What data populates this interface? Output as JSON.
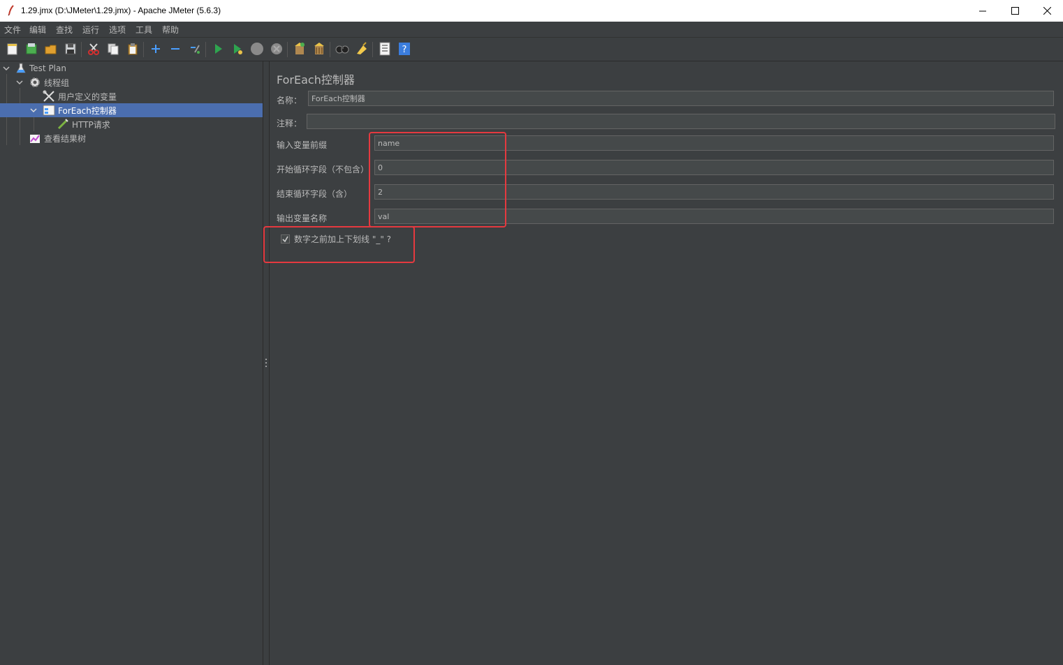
{
  "window": {
    "title": "1.29.jmx (D:\\JMeter\\1.29.jmx) - Apache JMeter (5.6.3)"
  },
  "menu": [
    "文件",
    "编辑",
    "查找",
    "运行",
    "选项",
    "工具",
    "帮助"
  ],
  "toolbar": [
    "new-icon",
    "templates-icon",
    "open-icon",
    "save-icon",
    "cut-icon",
    "copy-icon",
    "paste-icon",
    "expand-icon",
    "collapse-icon",
    "toggle-icon",
    "start-icon",
    "start-no-pauses-icon",
    "stop-icon",
    "shutdown-icon",
    "clear-icon",
    "clear-all-icon",
    "search-icon",
    "reset-search-icon",
    "function-helper-icon",
    "help-icon"
  ],
  "tree": {
    "nodes": [
      {
        "label": "Test Plan",
        "icon": "flask-icon"
      },
      {
        "label": "线程组",
        "icon": "gear-icon"
      },
      {
        "label": "用户定义的变量",
        "icon": "wrench-icon"
      },
      {
        "label": "ForEach控制器",
        "icon": "controller-icon",
        "selected": true
      },
      {
        "label": "HTTP请求",
        "icon": "pipette-icon"
      },
      {
        "label": "查看结果树",
        "icon": "chart-icon"
      }
    ]
  },
  "panel": {
    "title": "ForEach控制器",
    "name_label": "名称：",
    "name_value": "ForEach控制器",
    "comment_label": "注释：",
    "comment_value": "",
    "input_prefix_label": "输入变量前缀",
    "input_prefix_value": "name",
    "start_index_label": "开始循环字段（不包含）",
    "start_index_value": "0",
    "end_index_label": "结束循环字段（含）",
    "end_index_value": "2",
    "output_var_label": "输出变量名称",
    "output_var_value": "val",
    "underscore_checkbox_label": "数字之前加上下划线 \"_\" ?",
    "underscore_checked": true
  },
  "colors": {
    "background": "#3c3f41",
    "selection": "#4b6eaf",
    "highlight": "#e5393f",
    "input_bg": "#45494a"
  }
}
